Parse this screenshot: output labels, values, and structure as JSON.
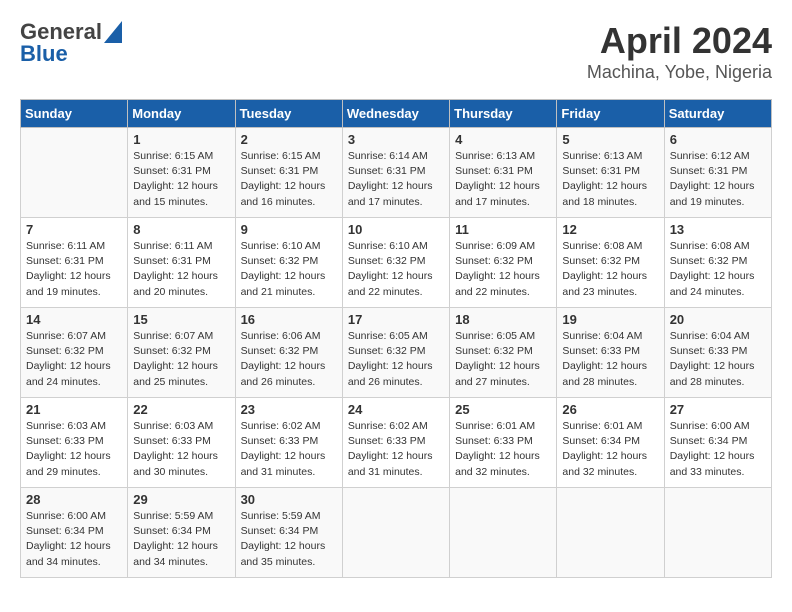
{
  "header": {
    "logo_line1": "General",
    "logo_line2": "Blue",
    "month_title": "April 2024",
    "location": "Machina, Yobe, Nigeria"
  },
  "weekdays": [
    "Sunday",
    "Monday",
    "Tuesday",
    "Wednesday",
    "Thursday",
    "Friday",
    "Saturday"
  ],
  "weeks": [
    [
      {
        "day": "",
        "info": ""
      },
      {
        "day": "1",
        "info": "Sunrise: 6:15 AM\nSunset: 6:31 PM\nDaylight: 12 hours\nand 15 minutes."
      },
      {
        "day": "2",
        "info": "Sunrise: 6:15 AM\nSunset: 6:31 PM\nDaylight: 12 hours\nand 16 minutes."
      },
      {
        "day": "3",
        "info": "Sunrise: 6:14 AM\nSunset: 6:31 PM\nDaylight: 12 hours\nand 17 minutes."
      },
      {
        "day": "4",
        "info": "Sunrise: 6:13 AM\nSunset: 6:31 PM\nDaylight: 12 hours\nand 17 minutes."
      },
      {
        "day": "5",
        "info": "Sunrise: 6:13 AM\nSunset: 6:31 PM\nDaylight: 12 hours\nand 18 minutes."
      },
      {
        "day": "6",
        "info": "Sunrise: 6:12 AM\nSunset: 6:31 PM\nDaylight: 12 hours\nand 19 minutes."
      }
    ],
    [
      {
        "day": "7",
        "info": "Sunrise: 6:11 AM\nSunset: 6:31 PM\nDaylight: 12 hours\nand 19 minutes."
      },
      {
        "day": "8",
        "info": "Sunrise: 6:11 AM\nSunset: 6:31 PM\nDaylight: 12 hours\nand 20 minutes."
      },
      {
        "day": "9",
        "info": "Sunrise: 6:10 AM\nSunset: 6:32 PM\nDaylight: 12 hours\nand 21 minutes."
      },
      {
        "day": "10",
        "info": "Sunrise: 6:10 AM\nSunset: 6:32 PM\nDaylight: 12 hours\nand 22 minutes."
      },
      {
        "day": "11",
        "info": "Sunrise: 6:09 AM\nSunset: 6:32 PM\nDaylight: 12 hours\nand 22 minutes."
      },
      {
        "day": "12",
        "info": "Sunrise: 6:08 AM\nSunset: 6:32 PM\nDaylight: 12 hours\nand 23 minutes."
      },
      {
        "day": "13",
        "info": "Sunrise: 6:08 AM\nSunset: 6:32 PM\nDaylight: 12 hours\nand 24 minutes."
      }
    ],
    [
      {
        "day": "14",
        "info": "Sunrise: 6:07 AM\nSunset: 6:32 PM\nDaylight: 12 hours\nand 24 minutes."
      },
      {
        "day": "15",
        "info": "Sunrise: 6:07 AM\nSunset: 6:32 PM\nDaylight: 12 hours\nand 25 minutes."
      },
      {
        "day": "16",
        "info": "Sunrise: 6:06 AM\nSunset: 6:32 PM\nDaylight: 12 hours\nand 26 minutes."
      },
      {
        "day": "17",
        "info": "Sunrise: 6:05 AM\nSunset: 6:32 PM\nDaylight: 12 hours\nand 26 minutes."
      },
      {
        "day": "18",
        "info": "Sunrise: 6:05 AM\nSunset: 6:32 PM\nDaylight: 12 hours\nand 27 minutes."
      },
      {
        "day": "19",
        "info": "Sunrise: 6:04 AM\nSunset: 6:33 PM\nDaylight: 12 hours\nand 28 minutes."
      },
      {
        "day": "20",
        "info": "Sunrise: 6:04 AM\nSunset: 6:33 PM\nDaylight: 12 hours\nand 28 minutes."
      }
    ],
    [
      {
        "day": "21",
        "info": "Sunrise: 6:03 AM\nSunset: 6:33 PM\nDaylight: 12 hours\nand 29 minutes."
      },
      {
        "day": "22",
        "info": "Sunrise: 6:03 AM\nSunset: 6:33 PM\nDaylight: 12 hours\nand 30 minutes."
      },
      {
        "day": "23",
        "info": "Sunrise: 6:02 AM\nSunset: 6:33 PM\nDaylight: 12 hours\nand 31 minutes."
      },
      {
        "day": "24",
        "info": "Sunrise: 6:02 AM\nSunset: 6:33 PM\nDaylight: 12 hours\nand 31 minutes."
      },
      {
        "day": "25",
        "info": "Sunrise: 6:01 AM\nSunset: 6:33 PM\nDaylight: 12 hours\nand 32 minutes."
      },
      {
        "day": "26",
        "info": "Sunrise: 6:01 AM\nSunset: 6:34 PM\nDaylight: 12 hours\nand 32 minutes."
      },
      {
        "day": "27",
        "info": "Sunrise: 6:00 AM\nSunset: 6:34 PM\nDaylight: 12 hours\nand 33 minutes."
      }
    ],
    [
      {
        "day": "28",
        "info": "Sunrise: 6:00 AM\nSunset: 6:34 PM\nDaylight: 12 hours\nand 34 minutes."
      },
      {
        "day": "29",
        "info": "Sunrise: 5:59 AM\nSunset: 6:34 PM\nDaylight: 12 hours\nand 34 minutes."
      },
      {
        "day": "30",
        "info": "Sunrise: 5:59 AM\nSunset: 6:34 PM\nDaylight: 12 hours\nand 35 minutes."
      },
      {
        "day": "",
        "info": ""
      },
      {
        "day": "",
        "info": ""
      },
      {
        "day": "",
        "info": ""
      },
      {
        "day": "",
        "info": ""
      }
    ]
  ]
}
